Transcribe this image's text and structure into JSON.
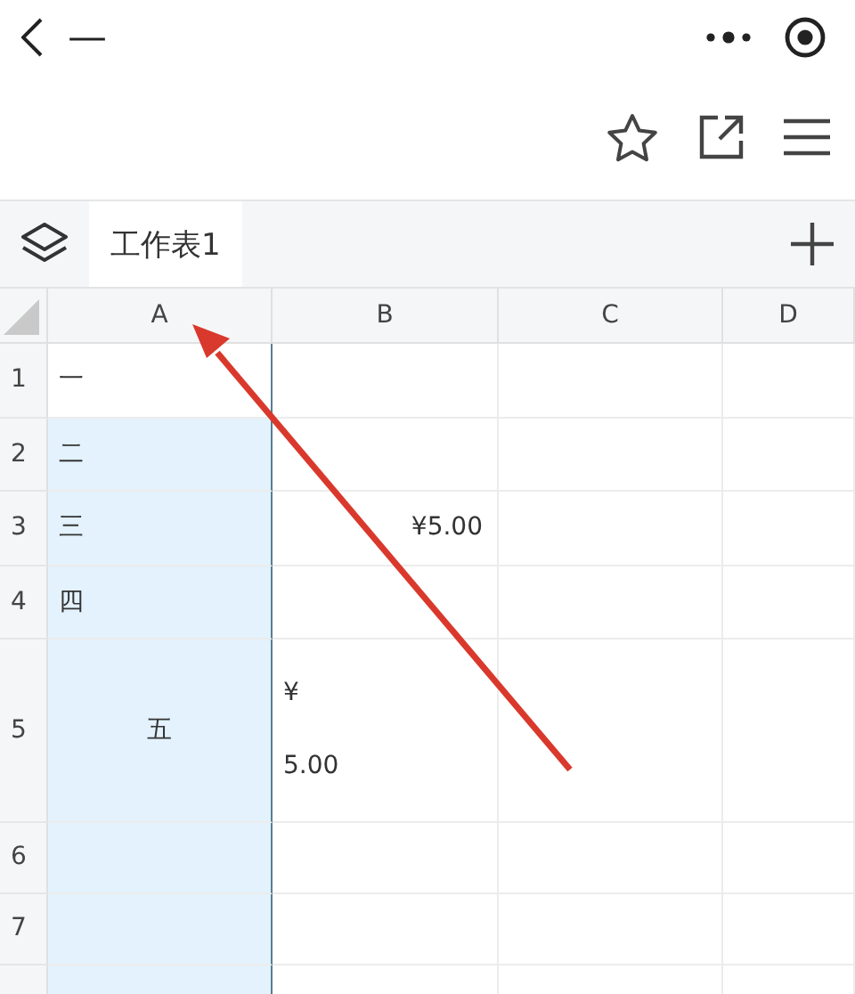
{
  "nav": {
    "title": "—"
  },
  "sheet_tabs": [
    {
      "label": "工作表1",
      "selected": true
    }
  ],
  "columns": [
    "A",
    "B",
    "C",
    "D"
  ],
  "rows": [
    {
      "header": "1",
      "cells": [
        {
          "text": "一",
          "kind": "text",
          "selected": false
        },
        {
          "selected": false
        },
        {
          "selected": false
        },
        {
          "selected": false
        }
      ]
    },
    {
      "header": "2",
      "cells": [
        {
          "text": "二",
          "kind": "text",
          "selected": true
        },
        {
          "selected": false
        },
        {
          "selected": false
        },
        {
          "selected": false
        }
      ]
    },
    {
      "header": "3",
      "cells": [
        {
          "text": "三",
          "kind": "text",
          "selected": true
        },
        {
          "text": "¥5.00",
          "kind": "number",
          "selected": false
        },
        {
          "selected": false
        },
        {
          "selected": false
        }
      ]
    },
    {
      "header": "4",
      "cells": [
        {
          "text": "四",
          "kind": "text",
          "selected": true
        },
        {
          "selected": false
        },
        {
          "selected": false
        },
        {
          "selected": false
        }
      ]
    },
    {
      "header": "5",
      "cells": [
        {
          "text": "五",
          "kind": "merged",
          "selected": true
        },
        {
          "text": "¥\n5.00",
          "kind": "wrapped",
          "selected": false
        },
        {
          "selected": false
        },
        {
          "selected": false
        }
      ]
    },
    {
      "header": "6",
      "cells": [
        {
          "selected": true
        },
        {
          "selected": false
        },
        {
          "selected": false
        },
        {
          "selected": false
        }
      ]
    },
    {
      "header": "7",
      "cells": [
        {
          "selected": true
        },
        {
          "selected": false
        },
        {
          "selected": false
        },
        {
          "selected": false
        }
      ]
    }
  ]
}
